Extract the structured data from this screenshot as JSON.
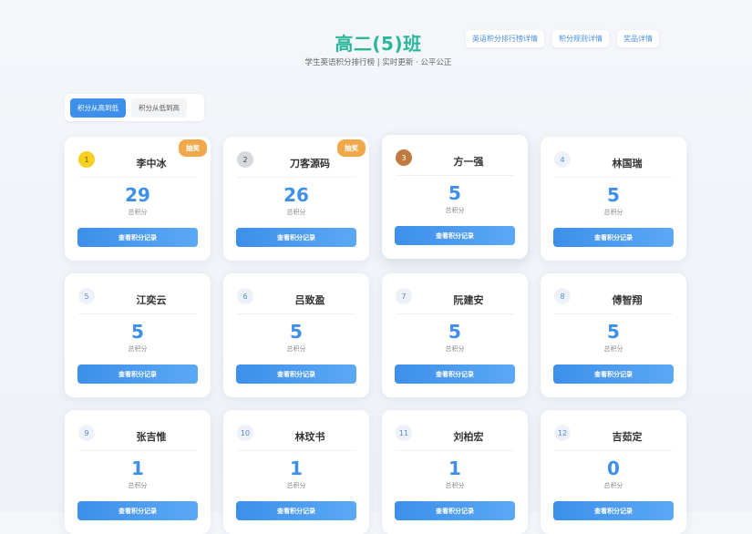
{
  "header": {
    "title": "高二(5)班",
    "subtitle": "学生英语积分排行榜 | 实时更新 · 公平公正",
    "links": [
      {
        "label": "英语积分排行榜详情"
      },
      {
        "label": "积分规则详情"
      },
      {
        "label": "奖品详情"
      }
    ]
  },
  "sort": {
    "high_to_low": "积分从高到低",
    "low_to_high": "积分从低到高"
  },
  "common": {
    "score_label": "总积分",
    "record_button": "查看积分记录",
    "lottery_badge": "抽奖"
  },
  "students": [
    {
      "rank": "1",
      "name": "李中冰",
      "score": "29"
    },
    {
      "rank": "2",
      "name": "刀客源码",
      "score": "26"
    },
    {
      "rank": "3",
      "name": "方一强",
      "score": "5"
    },
    {
      "rank": "4",
      "name": "林国瑞",
      "score": "5"
    },
    {
      "rank": "5",
      "name": "江奕云",
      "score": "5"
    },
    {
      "rank": "6",
      "name": "吕致盈",
      "score": "5"
    },
    {
      "rank": "7",
      "name": "阮建安",
      "score": "5"
    },
    {
      "rank": "8",
      "name": "傅智翔",
      "score": "5"
    },
    {
      "rank": "9",
      "name": "张吉惟",
      "score": "1"
    },
    {
      "rank": "10",
      "name": "林玟书",
      "score": "1"
    },
    {
      "rank": "11",
      "name": "刘柏宏",
      "score": "1"
    },
    {
      "rank": "12",
      "name": "吉茹定",
      "score": "0"
    }
  ],
  "colors": {
    "accent_green": "#2bb79a",
    "accent_blue": "#3d8fea",
    "badge_orange": "#f0a84a",
    "gold": "#f6d122",
    "silver": "#d7d9dd",
    "bronze": "#c07a3f"
  }
}
